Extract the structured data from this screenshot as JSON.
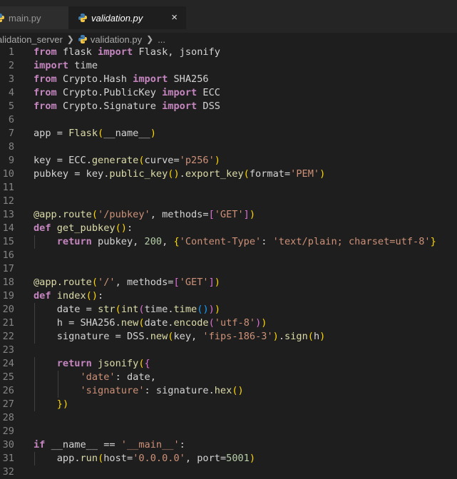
{
  "tabs": [
    {
      "name": "main.py",
      "active": false
    },
    {
      "name": "validation.py",
      "active": true
    }
  ],
  "close_icon": "×",
  "breadcrumb": {
    "folder": "alidation_server",
    "file": "validation.py",
    "symbol": "..."
  },
  "editor": {
    "lines": [
      "from flask import Flask, jsonify",
      "import time",
      "from Crypto.Hash import SHA256",
      "from Crypto.PublicKey import ECC",
      "from Crypto.Signature import DSS",
      "",
      "app = Flask(__name__)",
      "",
      "key = ECC.generate(curve='p256')",
      "pubkey = key.public_key().export_key(format='PEM')",
      "",
      "",
      "@app.route('/pubkey', methods=['GET'])",
      "def get_pubkey():",
      "    return pubkey, 200, {'Content-Type': 'text/plain; charset=utf-8'}",
      "",
      "",
      "@app.route('/', methods=['GET'])",
      "def index():",
      "    date = str(int(time.time()))",
      "    h = SHA256.new(date.encode('utf-8'))",
      "    signature = DSS.new(key, 'fips-186-3').sign(h)",
      "",
      "    return jsonify({",
      "        'date': date,",
      "        'signature': signature.hex()",
      "    })",
      "",
      "",
      "if __name__ == '__main__':",
      "    app.run(host='0.0.0.0', port=5001)",
      ""
    ]
  },
  "colors": {
    "background": "#1e1e1e",
    "keyword": "#c586c0",
    "function": "#dcdcaa",
    "string": "#ce9178",
    "number": "#b5cea8",
    "class": "#4ec9b0"
  }
}
